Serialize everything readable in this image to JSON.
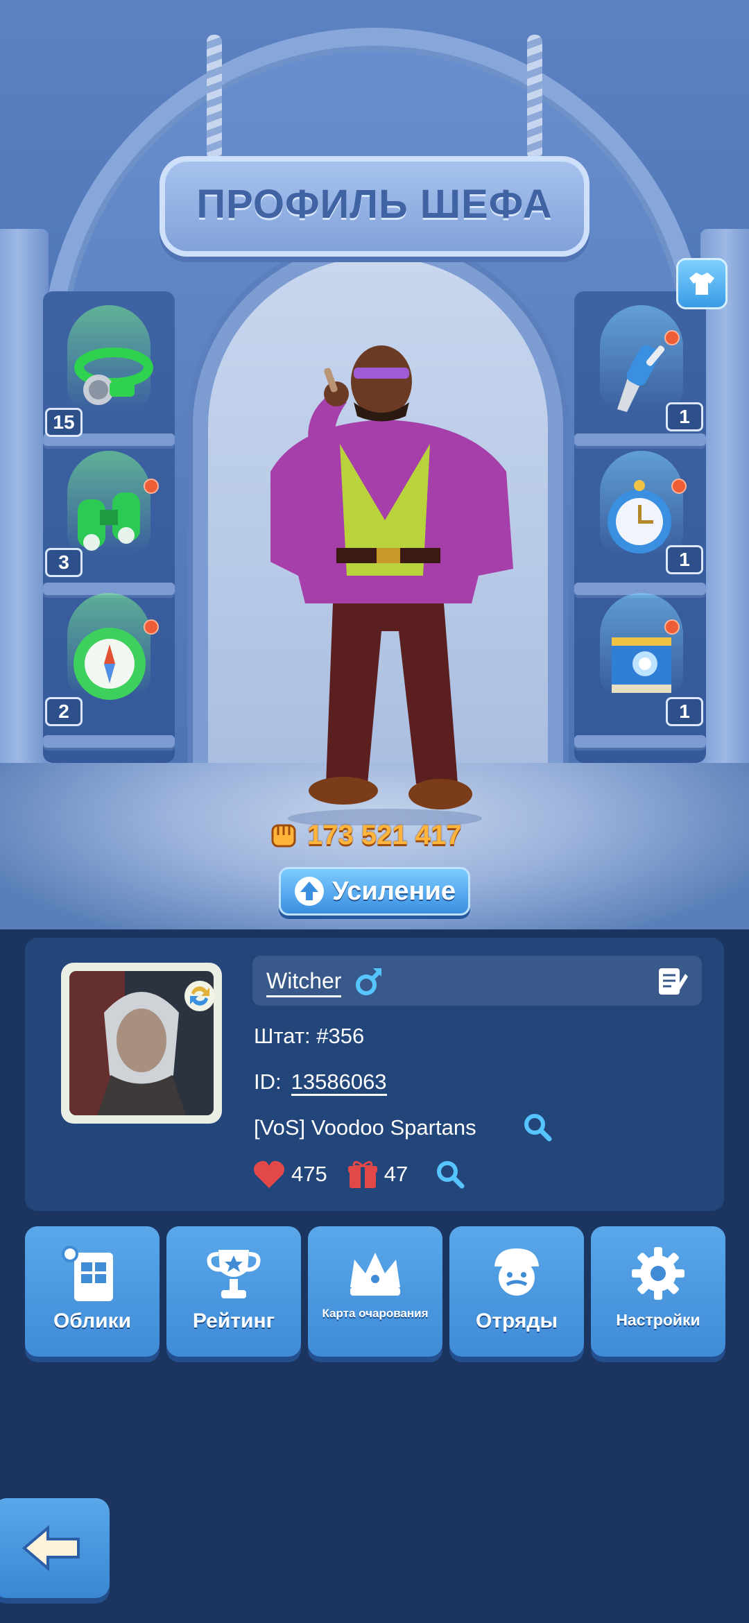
{
  "header": {
    "title": "ПРОФИЛЬ ШЕФА"
  },
  "left_items": [
    {
      "name": "headlamp",
      "count": "15",
      "glow": "green"
    },
    {
      "name": "binoculars",
      "count": "3",
      "glow": "green",
      "has_alert": true
    },
    {
      "name": "compass",
      "count": "2",
      "glow": "green",
      "has_alert": true
    }
  ],
  "right_items": [
    {
      "name": "pocket-knife",
      "count": "1",
      "glow": "blue",
      "has_alert": true
    },
    {
      "name": "pocket-watch",
      "count": "1",
      "glow": "blue",
      "has_alert": true
    },
    {
      "name": "book",
      "count": "1",
      "glow": "blue",
      "has_alert": true
    }
  ],
  "power": {
    "value": "173 521 417",
    "icon": "fist-icon"
  },
  "boost_button": {
    "label": "Усиление",
    "icon": "arrow-up-icon"
  },
  "profile": {
    "name": "Witcher",
    "gender_icon": "male-icon",
    "state_label": "Штат:",
    "state_value": "#356",
    "id_label": "ID:",
    "id_value": "13586063",
    "alliance": "[VoS] Voodoo Spartans",
    "likes": "475",
    "gifts": "47"
  },
  "menu": [
    {
      "label": "Облики",
      "icon": "wardrobe-icon"
    },
    {
      "label": "Рейтинг",
      "icon": "trophy-icon"
    },
    {
      "label": "Карта очарования",
      "icon": "crown-icon"
    },
    {
      "label": "Отряды",
      "icon": "squad-icon"
    },
    {
      "label": "Настройки",
      "icon": "gear-icon"
    }
  ],
  "colors": {
    "accent": "#3f8bd6",
    "panel": "#23467a",
    "power": "#ffb43b",
    "alert": "#ef5d36"
  }
}
